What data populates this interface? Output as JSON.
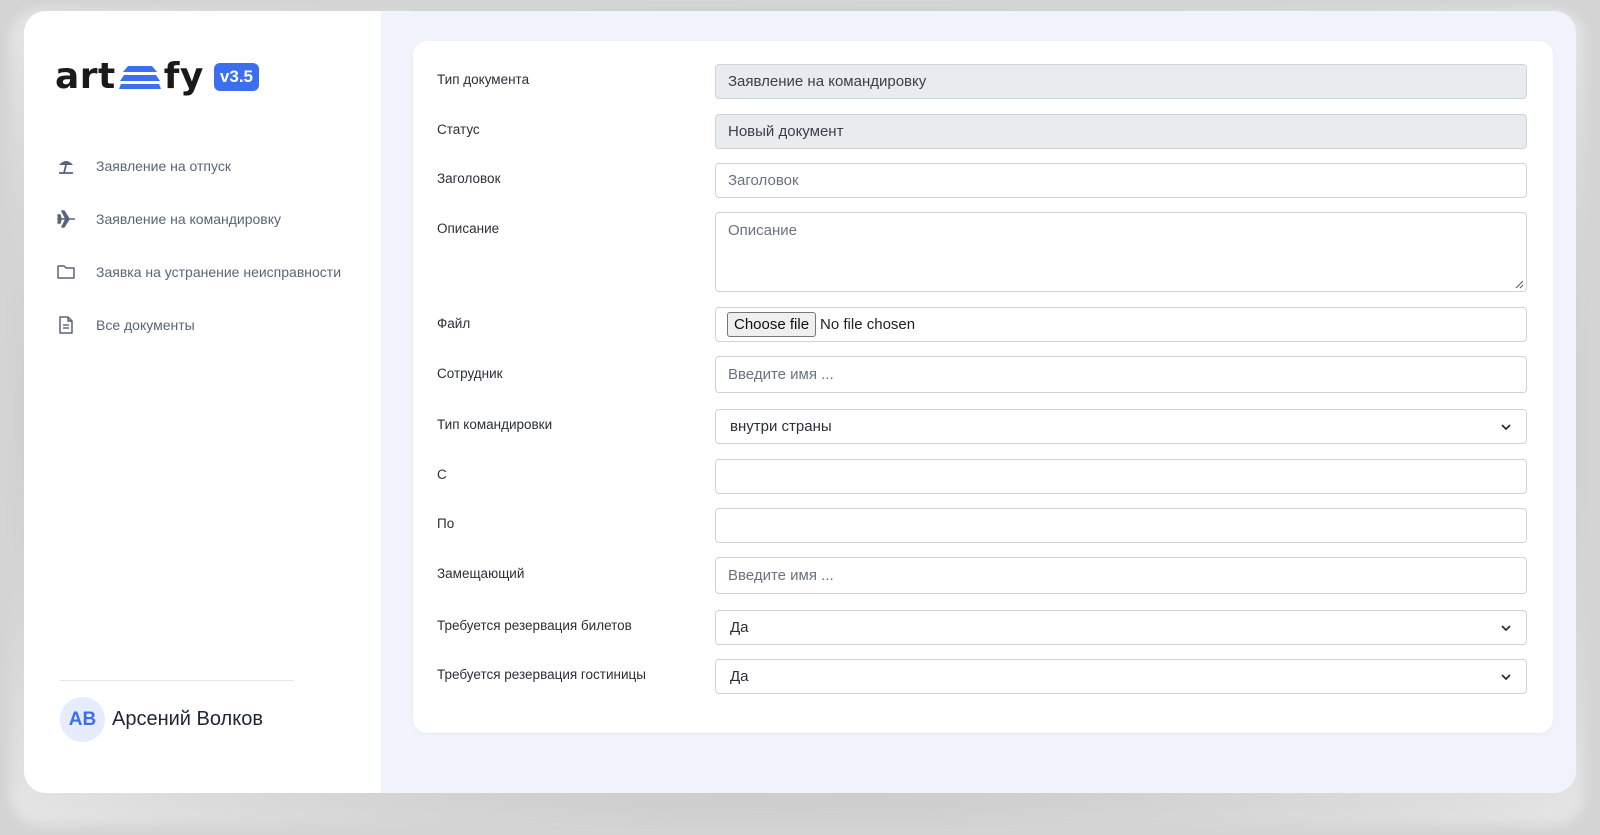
{
  "app": {
    "logo_left": "art",
    "logo_right": "fy",
    "version": "v3.5"
  },
  "sidebar": {
    "items": [
      {
        "label": "Заявление на отпуск",
        "icon": "beach-umbrella-icon"
      },
      {
        "label": "Заявление на командировку",
        "icon": "airplane-icon"
      },
      {
        "label": "Заявка на устранение неисправности",
        "icon": "folder-icon"
      },
      {
        "label": "Все документы",
        "icon": "document-icon"
      }
    ],
    "user": {
      "initials": "АВ",
      "name": "Арсений Волков"
    }
  },
  "form": {
    "doc_type": {
      "label": "Тип документа",
      "value": "Заявление на командировку"
    },
    "status": {
      "label": "Статус",
      "value": "Новый документ"
    },
    "title": {
      "label": "Заголовок",
      "placeholder": "Заголовок"
    },
    "description": {
      "label": "Описание",
      "placeholder": "Описание"
    },
    "file": {
      "label": "Файл",
      "button": "Choose file",
      "status": "No file chosen"
    },
    "employee": {
      "label": "Сотрудник",
      "placeholder": "Введите имя ..."
    },
    "trip_type": {
      "label": "Тип командировки",
      "value": "внутри страны"
    },
    "date_from": {
      "label": "С",
      "value": ""
    },
    "date_to": {
      "label": "По",
      "value": ""
    },
    "deputy": {
      "label": "Замещающий",
      "placeholder": "Введите имя ..."
    },
    "tickets": {
      "label": "Требуется резервация билетов",
      "value": "Да"
    },
    "hotel": {
      "label": "Требуется резервация гостиницы",
      "value": "Да"
    }
  },
  "colors": {
    "accent": "#3b6ff0",
    "sidebar_text": "#5a6478",
    "page_bg": "#f0f3fb"
  }
}
